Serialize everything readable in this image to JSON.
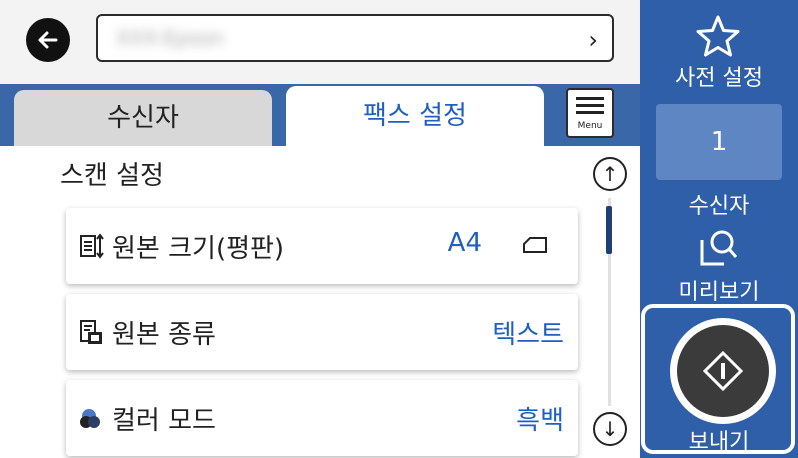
{
  "header": {
    "destination_value": "XXX-Epson",
    "chevron": "›"
  },
  "tabs": [
    {
      "label": "수신자",
      "active": false
    },
    {
      "label": "팩스 설정",
      "active": true
    }
  ],
  "menu": {
    "label": "Menu"
  },
  "section": {
    "title": "스캔 설정"
  },
  "scroll": {
    "up": "↑",
    "down": "↓"
  },
  "settings": [
    {
      "label": "원본 크기(평판)",
      "value": "A4",
      "icon": "original-size-icon"
    },
    {
      "label": "원본 종류",
      "value": "텍스트",
      "icon": "original-type-icon"
    },
    {
      "label": "컬러 모드",
      "value": "흑백",
      "icon": "color-mode-icon"
    }
  ],
  "side": {
    "preset_label": "사전 설정",
    "recipient_count": "1",
    "recipient_label": "수신자",
    "preview_label": "미리보기",
    "send_label": "보내기"
  },
  "colors": {
    "accent_blue": "#2e5fa8",
    "tab_bar": "#3a67a8",
    "value_blue": "#1f5fc1"
  }
}
